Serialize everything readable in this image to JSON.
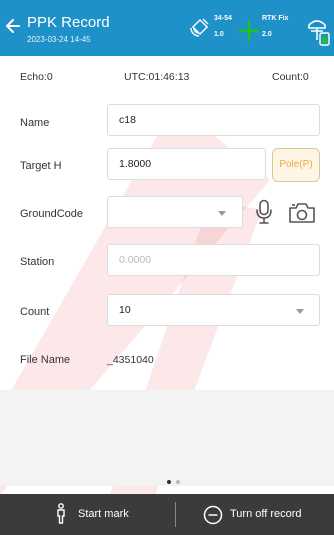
{
  "header": {
    "title": "PPK Record",
    "subtitle": "2023-03-24 14-45",
    "satellites": {
      "top": "34-54",
      "bottom": "1.0"
    },
    "fix_status": {
      "top": "RTK Fix",
      "bottom": "2.0"
    }
  },
  "info_row": {
    "echo": "Echo:0",
    "utc": "UTC:01:46:13",
    "count": "Count:0"
  },
  "form": {
    "name_label": "Name",
    "name_value": "c18",
    "target_h_label": "Target H",
    "target_h_value": "1.8000",
    "pole_button": "Pole(P)",
    "groundcode_label": "GroundCode",
    "groundcode_value": "",
    "station_label": "Station",
    "station_placeholder": "0.0000",
    "count_label": "Count",
    "count_value": "10",
    "file_name_label": "File Name",
    "file_name_value": "_4351040"
  },
  "pager": {
    "pages": 2,
    "active_page": 1
  },
  "bottom_bar": {
    "start_mark": "Start mark",
    "turn_off_record": "Turn off record"
  },
  "icons": {
    "back": "back-arrow-icon",
    "satellite": "satellite-icon",
    "fix": "crosshair-icon",
    "rover": "rover-battery-icon",
    "microphone": "microphone-icon",
    "camera": "camera-icon",
    "person": "person-icon",
    "minus_circle": "minus-circle-icon"
  },
  "colors": {
    "header_bg": "#1e91c9",
    "fix_green": "#1ec31e",
    "pole_text": "#f2a640",
    "bottom_bar_bg": "#3b3b3b"
  }
}
